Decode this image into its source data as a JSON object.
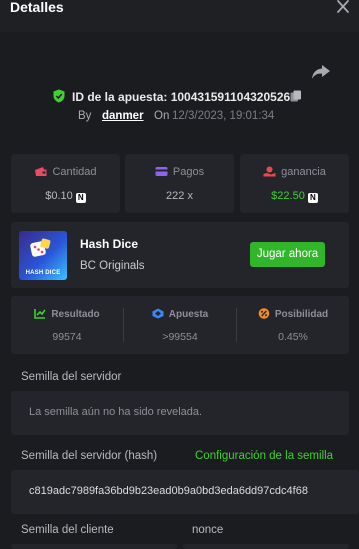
{
  "header": {
    "title": "Detalles"
  },
  "bet": {
    "id_label": "ID de la apuesta: 100431591104320526",
    "by_label": "By",
    "username": "danmer",
    "on_label": "On",
    "datetime": "12/3/2023, 19:01:34"
  },
  "stats": {
    "amount": {
      "label": "Cantidad",
      "value": "$0.10",
      "coin": "N"
    },
    "payout": {
      "label": "Pagos",
      "value": "222 x"
    },
    "profit": {
      "label": "ganancia",
      "value": "$22.50",
      "coin": "N"
    }
  },
  "game": {
    "name": "Hash Dice",
    "provider": "BC Originals",
    "thumb_label": "HASH DICE",
    "play_label": "Jugar ahora"
  },
  "result": {
    "result": {
      "label": "Resultado",
      "value": "99574"
    },
    "bet": {
      "label": "Apuesta",
      "value": ">99554"
    },
    "chance": {
      "label": "Posibilidad",
      "value": "0.45%"
    }
  },
  "seeds": {
    "server_label": "Semilla del servidor",
    "server_value": "La semilla aún no ha sido revelada.",
    "server_hash_label": "Semilla del servidor (hash)",
    "config_link": "Configuración de la semilla",
    "server_hash_value": "c819adc7989fa36bd9b23ead0b9a0bd3eda6dd97cdc4f68",
    "client_label": "Semilla del cliente",
    "nonce_label": "nonce"
  },
  "colors": {
    "accent_green": "#31b52a",
    "profit_green": "#3fd12e",
    "background": "#1b1c20",
    "panel": "#23252a"
  },
  "icons": [
    "close-icon",
    "share-icon",
    "shield-check-icon",
    "copy-icon",
    "wallet-icon",
    "card-icon",
    "money-hand-icon",
    "result-icon",
    "dice-icon",
    "percent-icon"
  ]
}
